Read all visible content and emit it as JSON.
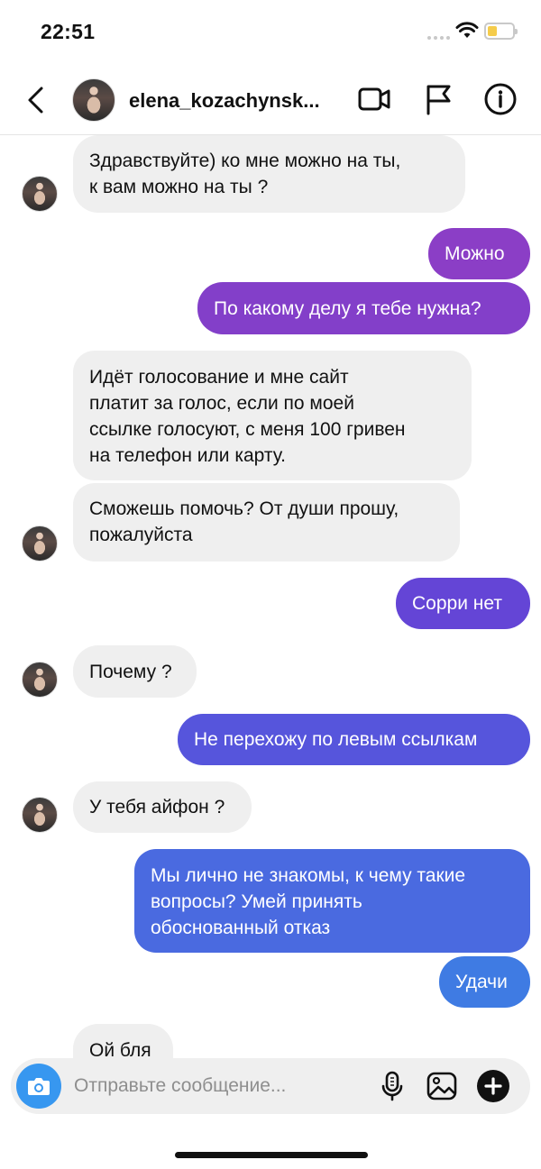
{
  "status_bar": {
    "time": "22:51"
  },
  "header": {
    "username": "elena_kozachynsk..."
  },
  "colors": {
    "out_top": "#8a3ec7",
    "out_bottom": "#3f7be3",
    "incoming_bg": "#efefef",
    "camera": "#3797f0"
  },
  "messages": [
    {
      "side": "in",
      "lines": [
        "Здравствуйте) ко мне можно на ты,",
        "к вам можно на ты ?"
      ],
      "avatar": true
    },
    {
      "side": "out",
      "lines": [
        "Можно"
      ]
    },
    {
      "side": "out",
      "lines": [
        "По какому делу я тебе нужна?"
      ]
    },
    {
      "side": "in",
      "lines": [
        "Идёт голосование и мне сайт",
        "платит за голос, если по моей",
        "ссылке голосуют, с меня 100 гривен",
        "на телефон или карту."
      ],
      "avatar": false
    },
    {
      "side": "in",
      "lines": [
        "Сможешь помочь? От души прошу,",
        "пожалуйста"
      ],
      "avatar": true
    },
    {
      "side": "out",
      "lines": [
        "Сорри нет"
      ]
    },
    {
      "side": "in",
      "lines": [
        "Почему ?"
      ],
      "avatar": true
    },
    {
      "side": "out",
      "lines": [
        "Не перехожу по левым ссылкам"
      ]
    },
    {
      "side": "in",
      "lines": [
        "У тебя айфон ?"
      ],
      "avatar": true
    },
    {
      "side": "out",
      "lines": [
        "Мы лично не знакомы, к чему такие",
        "вопросы? Умей принять",
        "обоснованный отказ"
      ]
    },
    {
      "side": "out",
      "lines": [
        "Удачи"
      ]
    },
    {
      "side": "in",
      "lines": [
        "Ой бля"
      ],
      "avatar": false
    }
  ],
  "composer": {
    "placeholder": "Отправьте сообщение..."
  }
}
